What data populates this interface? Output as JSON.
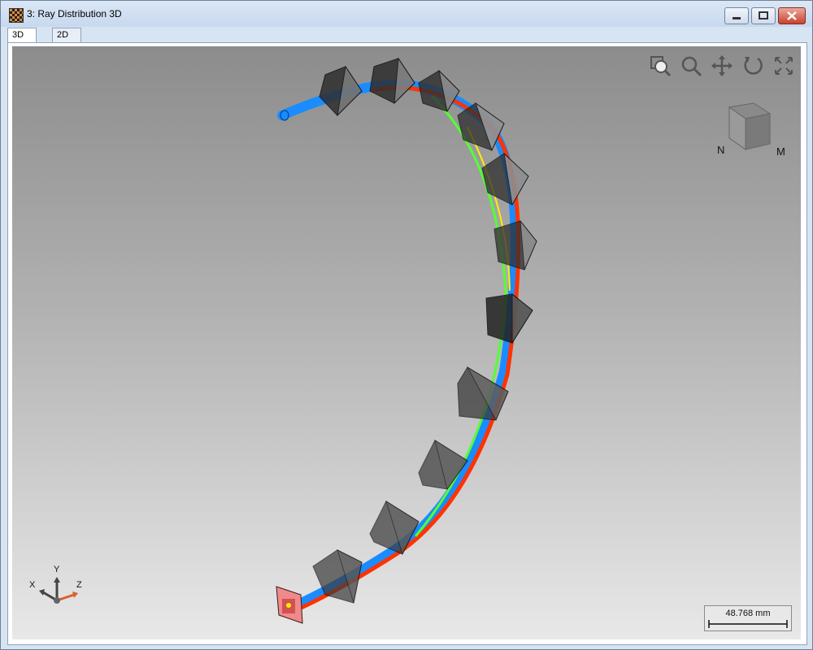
{
  "window": {
    "title": "3: Ray Distribution 3D",
    "buttons": [
      "minimize-icon",
      "maximize-icon",
      "close-icon"
    ]
  },
  "tabs": [
    {
      "label": "3D View",
      "active": true
    },
    {
      "label": "2D View",
      "active": false
    }
  ],
  "toolbar": {
    "icons": [
      "zoom-to-fit-icon",
      "zoom-icon",
      "pan-icon",
      "rotate-icon",
      "fullscreen-icon"
    ]
  },
  "orientation_cube": {
    "axis_labels": [
      "N",
      "M"
    ]
  },
  "axis_triad": {
    "x": "X",
    "y": "Y",
    "z": "Z"
  },
  "scale_bar": {
    "value": "48.768 mm"
  },
  "colors": {
    "ray_blue": "#1a8cff",
    "ray_red": "#ff3300",
    "ray_green": "#55ff33",
    "ray_yellow": "#ffee00",
    "prism": "#3a3a3a",
    "detector": "#f08a8a"
  }
}
